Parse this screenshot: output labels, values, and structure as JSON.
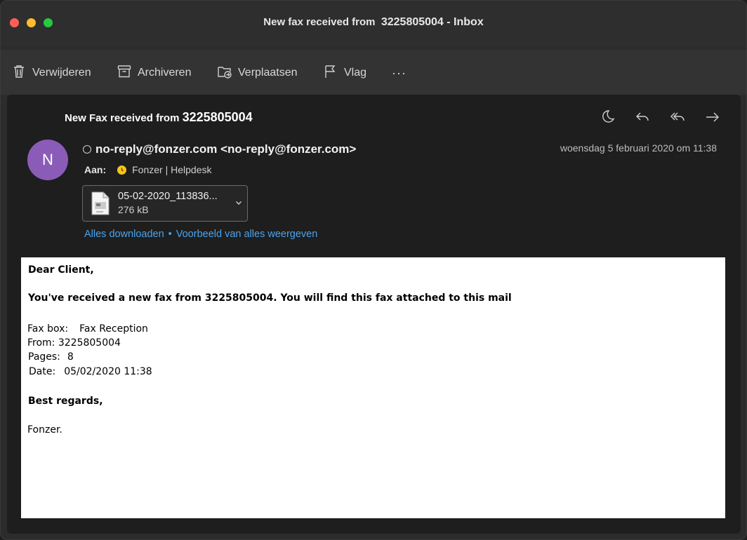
{
  "window": {
    "title_prefix": "New fax received from ",
    "title_number": "3225805004",
    "title_suffix": " - Inbox"
  },
  "toolbar": {
    "delete_label": "Verwijderen",
    "archive_label": "Archiveren",
    "move_label": "Verplaatsen",
    "flag_label": "Vlag",
    "more_label": "···"
  },
  "message": {
    "subject_prefix": "New Fax received from ",
    "subject_number": "3225805004",
    "avatar_initial": "N",
    "sender": "no-reply@fonzer.com <no-reply@fonzer.com>",
    "date": "woensdag 5 februari 2020 om 11:38",
    "to_label": "Aan:",
    "to_name": "Fonzer | Helpdesk",
    "attachment": {
      "name": "05-02-2020_113836...",
      "size": "276 kB"
    },
    "download_all": "Alles downloaden",
    "separator": "•",
    "preview_all": "Voorbeeld van alles weergeven"
  },
  "body": {
    "greeting": "Dear Client,",
    "intro": "You've received a new fax from 3225805004. You will find this fax attached to this mail",
    "faxbox_label": "Fax box:",
    "faxbox_value": "Fax Reception",
    "from_line": "From: 3225805004",
    "pages_label": "Pages:",
    "pages_value": "8",
    "date_label": "Date:",
    "date_value": "05/02/2020 11:38",
    "closing": "Best regards,",
    "signature": "Fonzer."
  },
  "colors": {
    "accent_link": "#4aa3f0",
    "avatar": "#8a5cb8",
    "status_dot": "#f5c518"
  }
}
